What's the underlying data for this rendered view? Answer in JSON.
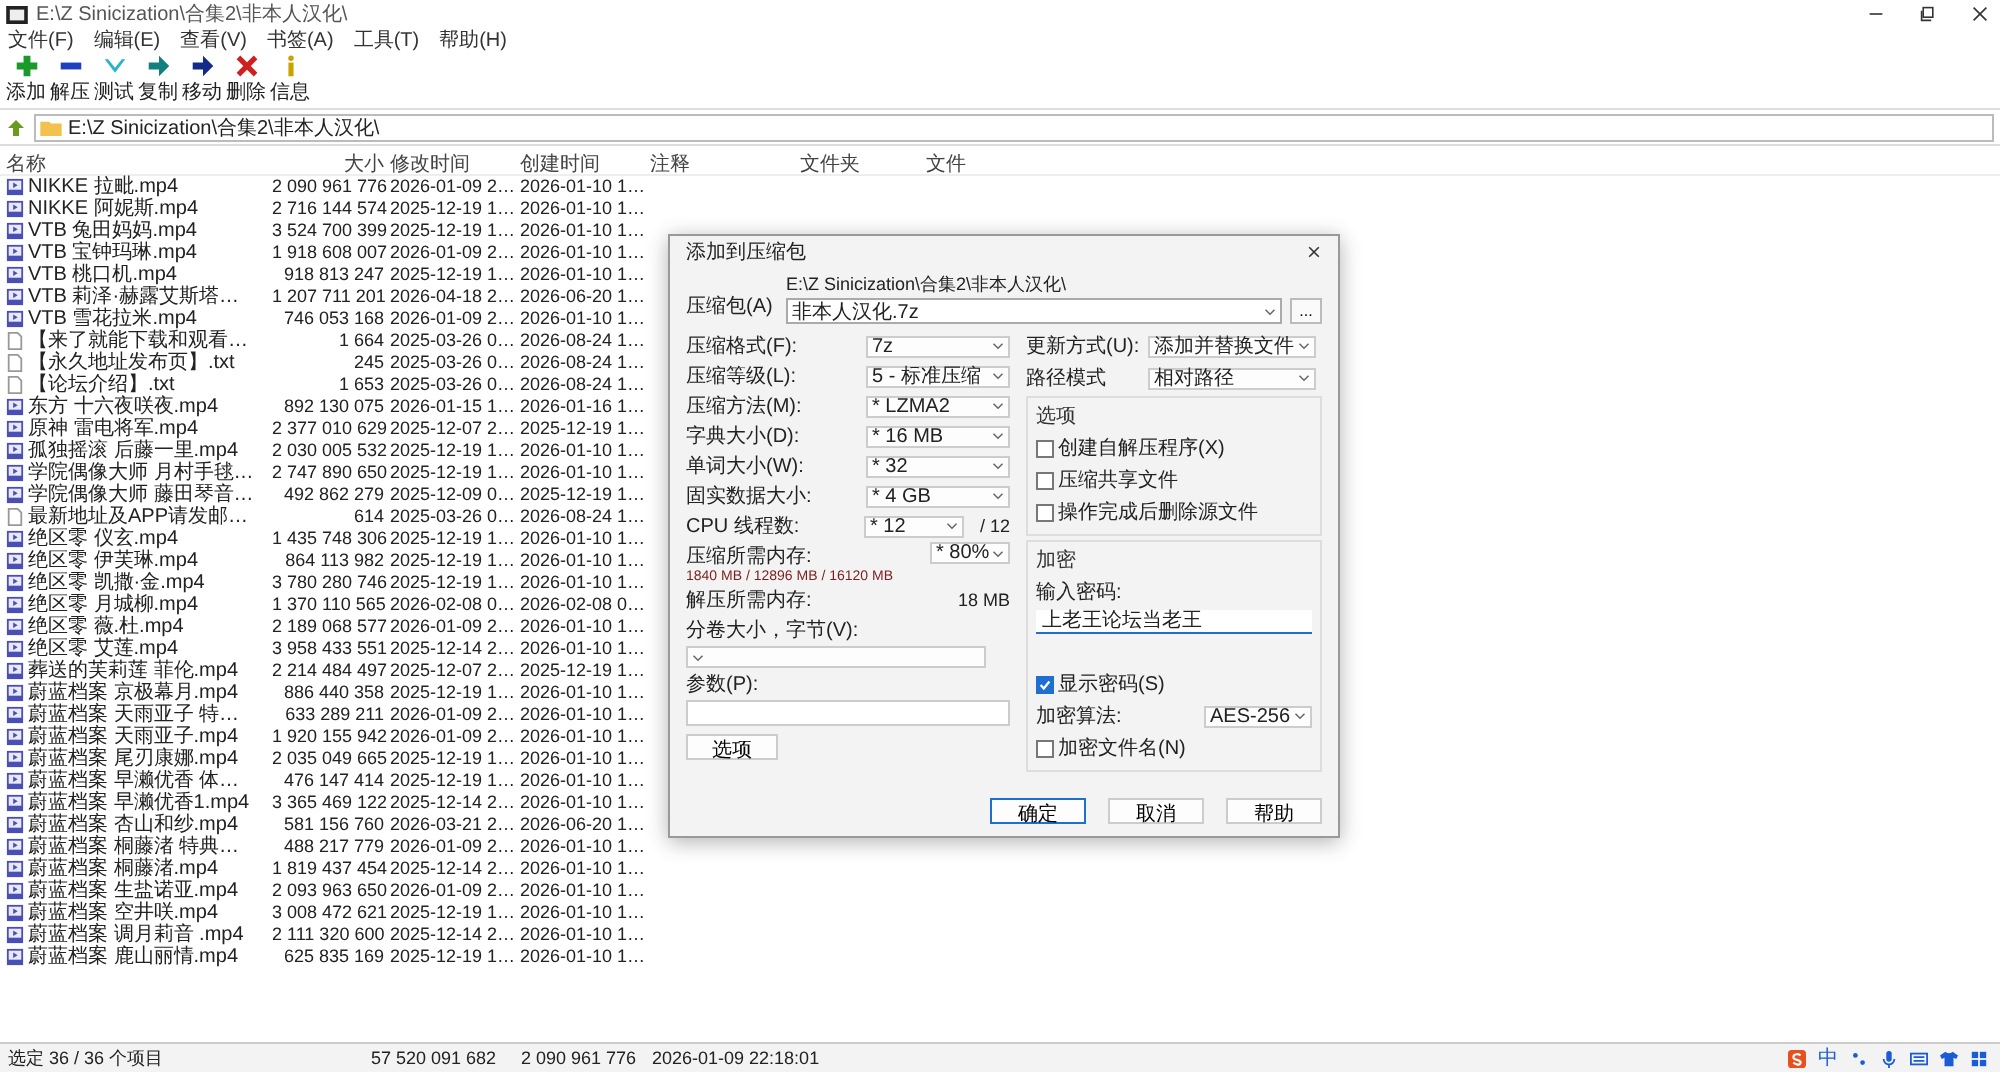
{
  "window": {
    "title": "E:\\Z Sinicization\\合集2\\非本人汉化\\"
  },
  "menu": [
    "文件(F)",
    "编辑(E)",
    "查看(V)",
    "书签(A)",
    "工具(T)",
    "帮助(H)"
  ],
  "toolbar": [
    {
      "label": "添加",
      "kind": "add"
    },
    {
      "label": "解压",
      "kind": "extract"
    },
    {
      "label": "测试",
      "kind": "test"
    },
    {
      "label": "复制",
      "kind": "copy"
    },
    {
      "label": "移动",
      "kind": "move"
    },
    {
      "label": "删除",
      "kind": "delete"
    },
    {
      "label": "信息",
      "kind": "info"
    }
  ],
  "address": "E:\\Z Sinicization\\合集2\\非本人汉化\\",
  "columns": [
    "名称",
    "大小",
    "修改时间",
    "创建时间",
    "注释",
    "文件夹",
    "文件"
  ],
  "rows": [
    {
      "kind": "video",
      "name": "NIKKE 拉毗.mp4",
      "size": "2 090 961 776",
      "modified": "2026-01-09 2…",
      "created": "2026-01-10 1…"
    },
    {
      "kind": "video",
      "name": "NIKKE 阿妮斯.mp4",
      "size": "2 716 144 574",
      "modified": "2025-12-19 1…",
      "created": "2026-01-10 1…"
    },
    {
      "kind": "video",
      "name": "VTB 兔田妈妈.mp4",
      "size": "3 524 700 399",
      "modified": "2025-12-19 1…",
      "created": "2026-01-10 1…"
    },
    {
      "kind": "video",
      "name": "VTB 宝钟玛琳.mp4",
      "size": "1 918 608 007",
      "modified": "2026-01-09 2…",
      "created": "2026-01-10 1…"
    },
    {
      "kind": "video",
      "name": "VTB 桃口机.mp4",
      "size": "918 813 247",
      "modified": "2025-12-19 1…",
      "created": "2026-01-10 1…"
    },
    {
      "kind": "video",
      "name": "VTB 莉泽·赫露艾斯塔…",
      "size": "1 207 711 201",
      "modified": "2026-04-18 2…",
      "created": "2026-06-20 1…"
    },
    {
      "kind": "video",
      "name": "VTB 雪花拉米.mp4",
      "size": "746 053 168",
      "modified": "2026-01-09 2…",
      "created": "2026-01-10 1…"
    },
    {
      "kind": "text",
      "name": "【来了就能下载和观看…",
      "size": "1 664",
      "modified": "2025-03-26 0…",
      "created": "2026-08-24 1…"
    },
    {
      "kind": "text",
      "name": "【永久地址发布页】.txt",
      "size": "245",
      "modified": "2025-03-26 0…",
      "created": "2026-08-24 1…"
    },
    {
      "kind": "text",
      "name": "【论坛介绍】.txt",
      "size": "1 653",
      "modified": "2025-03-26 0…",
      "created": "2026-08-24 1…"
    },
    {
      "kind": "video",
      "name": "东方 十六夜咲夜.mp4",
      "size": "892 130 075",
      "modified": "2026-01-15 1…",
      "created": "2026-01-16 1…"
    },
    {
      "kind": "video",
      "name": "原神 雷电将军.mp4",
      "size": "2 377 010 629",
      "modified": "2025-12-07 2…",
      "created": "2025-12-19 1…"
    },
    {
      "kind": "video",
      "name": "孤独摇滚 后藤一里.mp4",
      "size": "2 030 005 532",
      "modified": "2025-12-19 1…",
      "created": "2026-01-10 1…"
    },
    {
      "kind": "video",
      "name": "学院偶像大师 月村手毬…",
      "size": "2 747 890 650",
      "modified": "2025-12-19 1…",
      "created": "2026-01-10 1…"
    },
    {
      "kind": "video",
      "name": "学院偶像大师 藤田琴音…",
      "size": "492 862 279",
      "modified": "2025-12-09 0…",
      "created": "2025-12-19 1…"
    },
    {
      "kind": "text",
      "name": "最新地址及APP请发邮…",
      "size": "614",
      "modified": "2025-03-26 0…",
      "created": "2026-08-24 1…"
    },
    {
      "kind": "video",
      "name": "绝区零 仪玄.mp4",
      "size": "1 435 748 306",
      "modified": "2025-12-19 1…",
      "created": "2026-01-10 1…"
    },
    {
      "kind": "video",
      "name": "绝区零 伊芙琳.mp4",
      "size": "864 113 982",
      "modified": "2025-12-19 1…",
      "created": "2026-01-10 1…"
    },
    {
      "kind": "video",
      "name": "绝区零 凯撒·金.mp4",
      "size": "3 780 280 746",
      "modified": "2025-12-19 1…",
      "created": "2026-01-10 1…"
    },
    {
      "kind": "video",
      "name": "绝区零 月城柳.mp4",
      "size": "1 370 110 565",
      "modified": "2026-02-08 0…",
      "created": "2026-02-08 0…"
    },
    {
      "kind": "video",
      "name": "绝区零 薇.杜.mp4",
      "size": "2 189 068 577",
      "modified": "2026-01-09 2…",
      "created": "2026-01-10 1…"
    },
    {
      "kind": "video",
      "name": "绝区零 艾莲.mp4",
      "size": "3 958 433 551",
      "modified": "2025-12-14 2…",
      "created": "2026-01-10 1…"
    },
    {
      "kind": "video",
      "name": "葬送的芙莉莲 菲伦.mp4",
      "size": "2 214 484 497",
      "modified": "2025-12-07 2…",
      "created": "2025-12-19 1…"
    },
    {
      "kind": "video",
      "name": "蔚蓝档案 京极幕月.mp4",
      "size": "886 440 358",
      "modified": "2025-12-19 1…",
      "created": "2026-01-10 1…"
    },
    {
      "kind": "video",
      "name": "蔚蓝档案 天雨亚子 特…",
      "size": "633 289 211",
      "modified": "2026-01-09 2…",
      "created": "2026-01-10 1…"
    },
    {
      "kind": "video",
      "name": "蔚蓝档案 天雨亚子.mp4",
      "size": "1 920 155 942",
      "modified": "2026-01-09 2…",
      "created": "2026-01-10 1…"
    },
    {
      "kind": "video",
      "name": "蔚蓝档案 尾刃康娜.mp4",
      "size": "2 035 049 665",
      "modified": "2025-12-19 1…",
      "created": "2026-01-10 1…"
    },
    {
      "kind": "video",
      "name": "蔚蓝档案 早濑优香 体…",
      "size": "476 147 414",
      "modified": "2025-12-19 1…",
      "created": "2026-01-10 1…"
    },
    {
      "kind": "video",
      "name": "蔚蓝档案 早濑优香1.mp4",
      "size": "3 365 469 122",
      "modified": "2025-12-14 2…",
      "created": "2026-01-10 1…"
    },
    {
      "kind": "video",
      "name": "蔚蓝档案 杏山和纱.mp4",
      "size": "581 156 760",
      "modified": "2026-03-21 2…",
      "created": "2026-06-20 1…"
    },
    {
      "kind": "video",
      "name": "蔚蓝档案 桐藤渚 特典…",
      "size": "488 217 779",
      "modified": "2026-01-09 2…",
      "created": "2026-01-10 1…"
    },
    {
      "kind": "video",
      "name": "蔚蓝档案 桐藤渚.mp4",
      "size": "1 819 437 454",
      "modified": "2025-12-14 2…",
      "created": "2026-01-10 1…"
    },
    {
      "kind": "video",
      "name": "蔚蓝档案 生盐诺亚.mp4",
      "size": "2 093 963 650",
      "modified": "2026-01-09 2…",
      "created": "2026-01-10 1…"
    },
    {
      "kind": "video",
      "name": "蔚蓝档案 空井咲.mp4",
      "size": "3 008 472 621",
      "modified": "2025-12-19 1…",
      "created": "2026-01-10 1…"
    },
    {
      "kind": "video",
      "name": "蔚蓝档案 调月莉音 .mp4",
      "size": "2 111 320 600",
      "modified": "2025-12-14 2…",
      "created": "2026-01-10 1…"
    },
    {
      "kind": "video",
      "name": "蔚蓝档案 鹿山丽情.mp4",
      "size": "625 835 169",
      "modified": "2025-12-19 1…",
      "created": "2026-01-10 1…"
    }
  ],
  "status_bar": [
    "选定 36 / 36 个项目",
    "57 520 091 682",
    "2 090 961 776",
    "2026-01-09 22:18:01"
  ],
  "tray": {
    "ime": "中"
  },
  "dialog": {
    "title": "添加到压缩包",
    "archive": {
      "label": "压缩包(A)",
      "path": "E:\\Z Sinicization\\合集2\\非本人汉化\\",
      "value": "非本人汉化.7z"
    },
    "browse_button": "...",
    "left_fields": [
      {
        "label": "压缩格式(F):",
        "value": "7z"
      },
      {
        "label": "压缩等级(L):",
        "value": "5 - 标准压缩"
      },
      {
        "label": "压缩方法(M):",
        "value": "* LZMA2"
      },
      {
        "label": "字典大小(D):",
        "value": "* 16 MB"
      },
      {
        "label": "单词大小(W):",
        "value": "* 32"
      },
      {
        "label": "固实数据大小:",
        "value": "* 4 GB"
      }
    ],
    "threads": {
      "label": "CPU 线程数:",
      "value": "* 12",
      "max": "/ 12"
    },
    "memory": {
      "label": "压缩所需内存:",
      "detail": "1840 MB / 12896 MB / 16120 MB",
      "value": "* 80%"
    },
    "decompress_memory": {
      "label": "解压所需内存:",
      "value": "18 MB"
    },
    "volume": {
      "label": "分卷大小，字节(V):"
    },
    "params": {
      "label": "参数(P):"
    },
    "options_button": "选项",
    "right_fields": [
      {
        "label": "更新方式(U):",
        "value": "添加并替换文件"
      },
      {
        "label": "路径模式",
        "value": "相对路径"
      }
    ],
    "options": {
      "title": "选项",
      "checkboxes": [
        {
          "label": "创建自解压程序(X)",
          "checked": false
        },
        {
          "label": "压缩共享文件",
          "checked": false
        },
        {
          "label": "操作完成后删除源文件",
          "checked": false
        }
      ]
    },
    "encryption": {
      "title": "加密",
      "password_label": "输入密码:",
      "password": "上老王论坛当老王",
      "show_password": {
        "label": "显示密码(S)",
        "checked": true
      },
      "method": {
        "label": "加密算法:",
        "value": "AES-256"
      },
      "encrypt_names": {
        "label": "加密文件名(N)",
        "checked": false
      }
    },
    "buttons": [
      {
        "label": "确定",
        "default": true
      },
      {
        "label": "取消",
        "default": false
      },
      {
        "label": "帮助",
        "default": false
      }
    ]
  }
}
